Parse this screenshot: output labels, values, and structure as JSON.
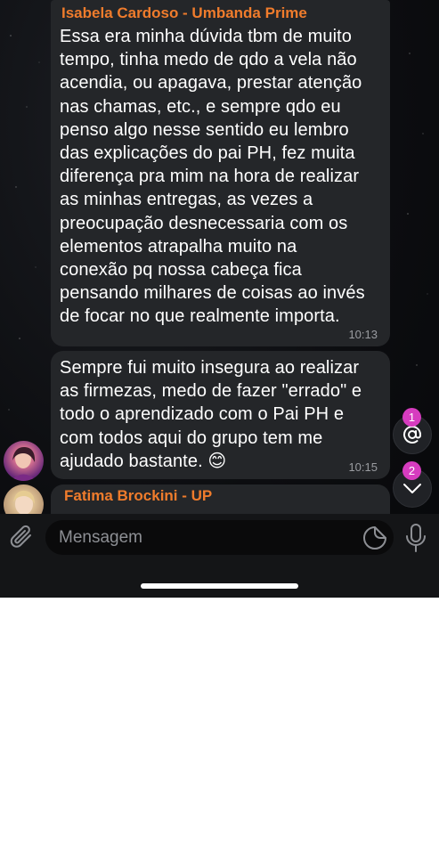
{
  "messages": [
    {
      "sender": "Isabela Cardoso - Umbanda Prime",
      "text": "Essa era minha dúvida tbm de muito\ntempo, tinha medo de qdo a vela não\nacendia, ou apagava, prestar atenção\nnas chamas, etc., e sempre qdo eu\npenso algo nesse sentido eu lembro\ndas explicações do pai PH, fez muita\ndiferença pra mim na hora de realizar\nas minhas entregas, as vezes a\npreocupação desnecessaria com os\nelementos atrapalha muito na\nconexão pq nossa cabeça fica\npensando milhares de coisas ao invés\nde focar no que realmente importa.",
      "time": "10:13"
    },
    {
      "text": "Sempre fui muito insegura ao realizar\nas firmezas, medo de fazer \"errado\" e\ntodo o aprendizado com o Pai PH e\ncom todos aqui do grupo tem me\najudado bastante. 😊",
      "time": "10:15"
    },
    {
      "sender": "Fatima Brockini - UP"
    }
  ],
  "badges": {
    "mentions": "1",
    "unread": "2"
  },
  "input": {
    "placeholder": "Mensagem"
  },
  "icons": {
    "attach": "paperclip-icon",
    "sticker": "sticker-icon",
    "mic": "microphone-icon",
    "mention": "at-sign-icon",
    "scroll_down": "chevron-down-icon"
  },
  "colors": {
    "sender": "#f07c2c",
    "badge": "#d63cbf",
    "bubble": "#242629"
  }
}
